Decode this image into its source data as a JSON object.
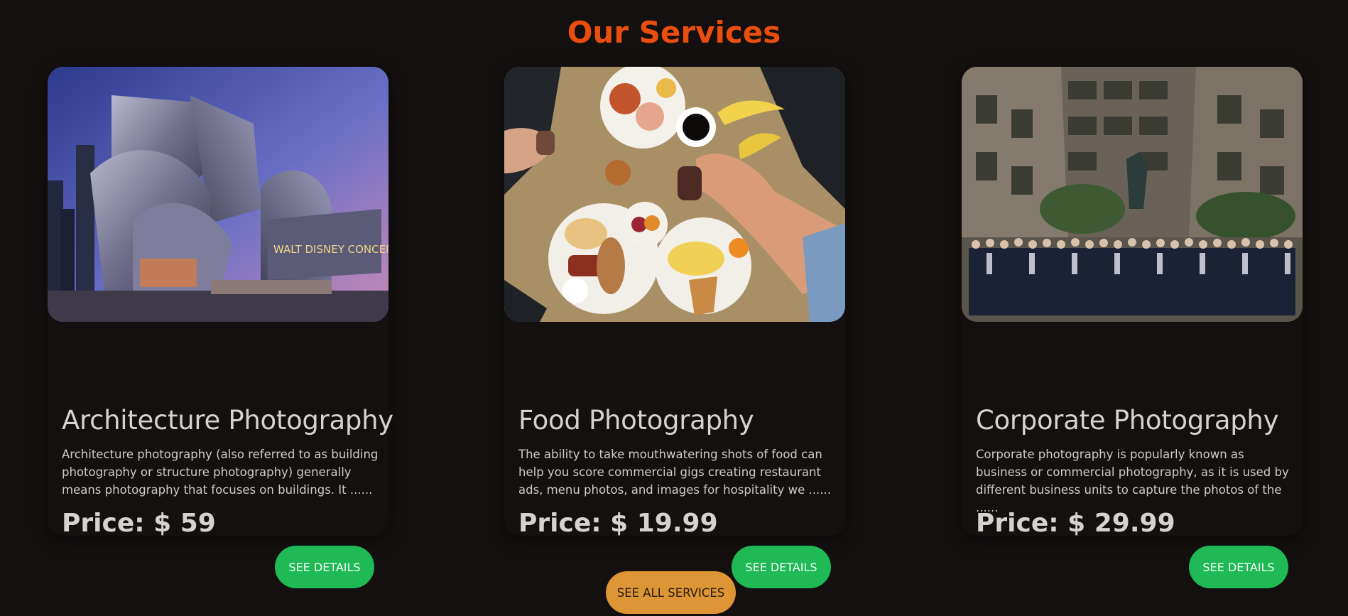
{
  "section": {
    "title": "Our Services"
  },
  "cards": [
    {
      "image_alt": "architecture-photo",
      "image_overlay_text": "WALT DISNEY CONCERT HALL",
      "title": "Architecture Photography",
      "description": "Architecture photography (also referred to as building photography or structure photography) generally means photography that focuses on buildings. It ......",
      "price_prefix": "Price: $ ",
      "price_value": "59",
      "button_label": "SEE DETAILS"
    },
    {
      "image_alt": "food-photo",
      "title": "Food Photography",
      "description": "The ability to take mouthwatering shots of food can help you score commercial gigs creating restaurant ads, menu photos, and images for hospitality we ......",
      "price_prefix": "Price: $ ",
      "price_value": "19.99",
      "button_label": "SEE DETAILS"
    },
    {
      "image_alt": "corporate-photo",
      "title": "Corporate Photography",
      "description": "Corporate photography is popularly known as business or commercial photography, as it is used by different business units to capture the photos of the ......",
      "price_prefix": "Price: $ ",
      "price_value": "29.99",
      "button_label": "SEE DETAILS"
    }
  ],
  "footer": {
    "all_services_label": "SEE ALL SERVICES"
  },
  "colors": {
    "background": "#141010",
    "title_accent": "#ea4e0e",
    "details_button": "#1fb955",
    "all_services_button": "#de9536",
    "card_text": "#d6d2d2"
  }
}
